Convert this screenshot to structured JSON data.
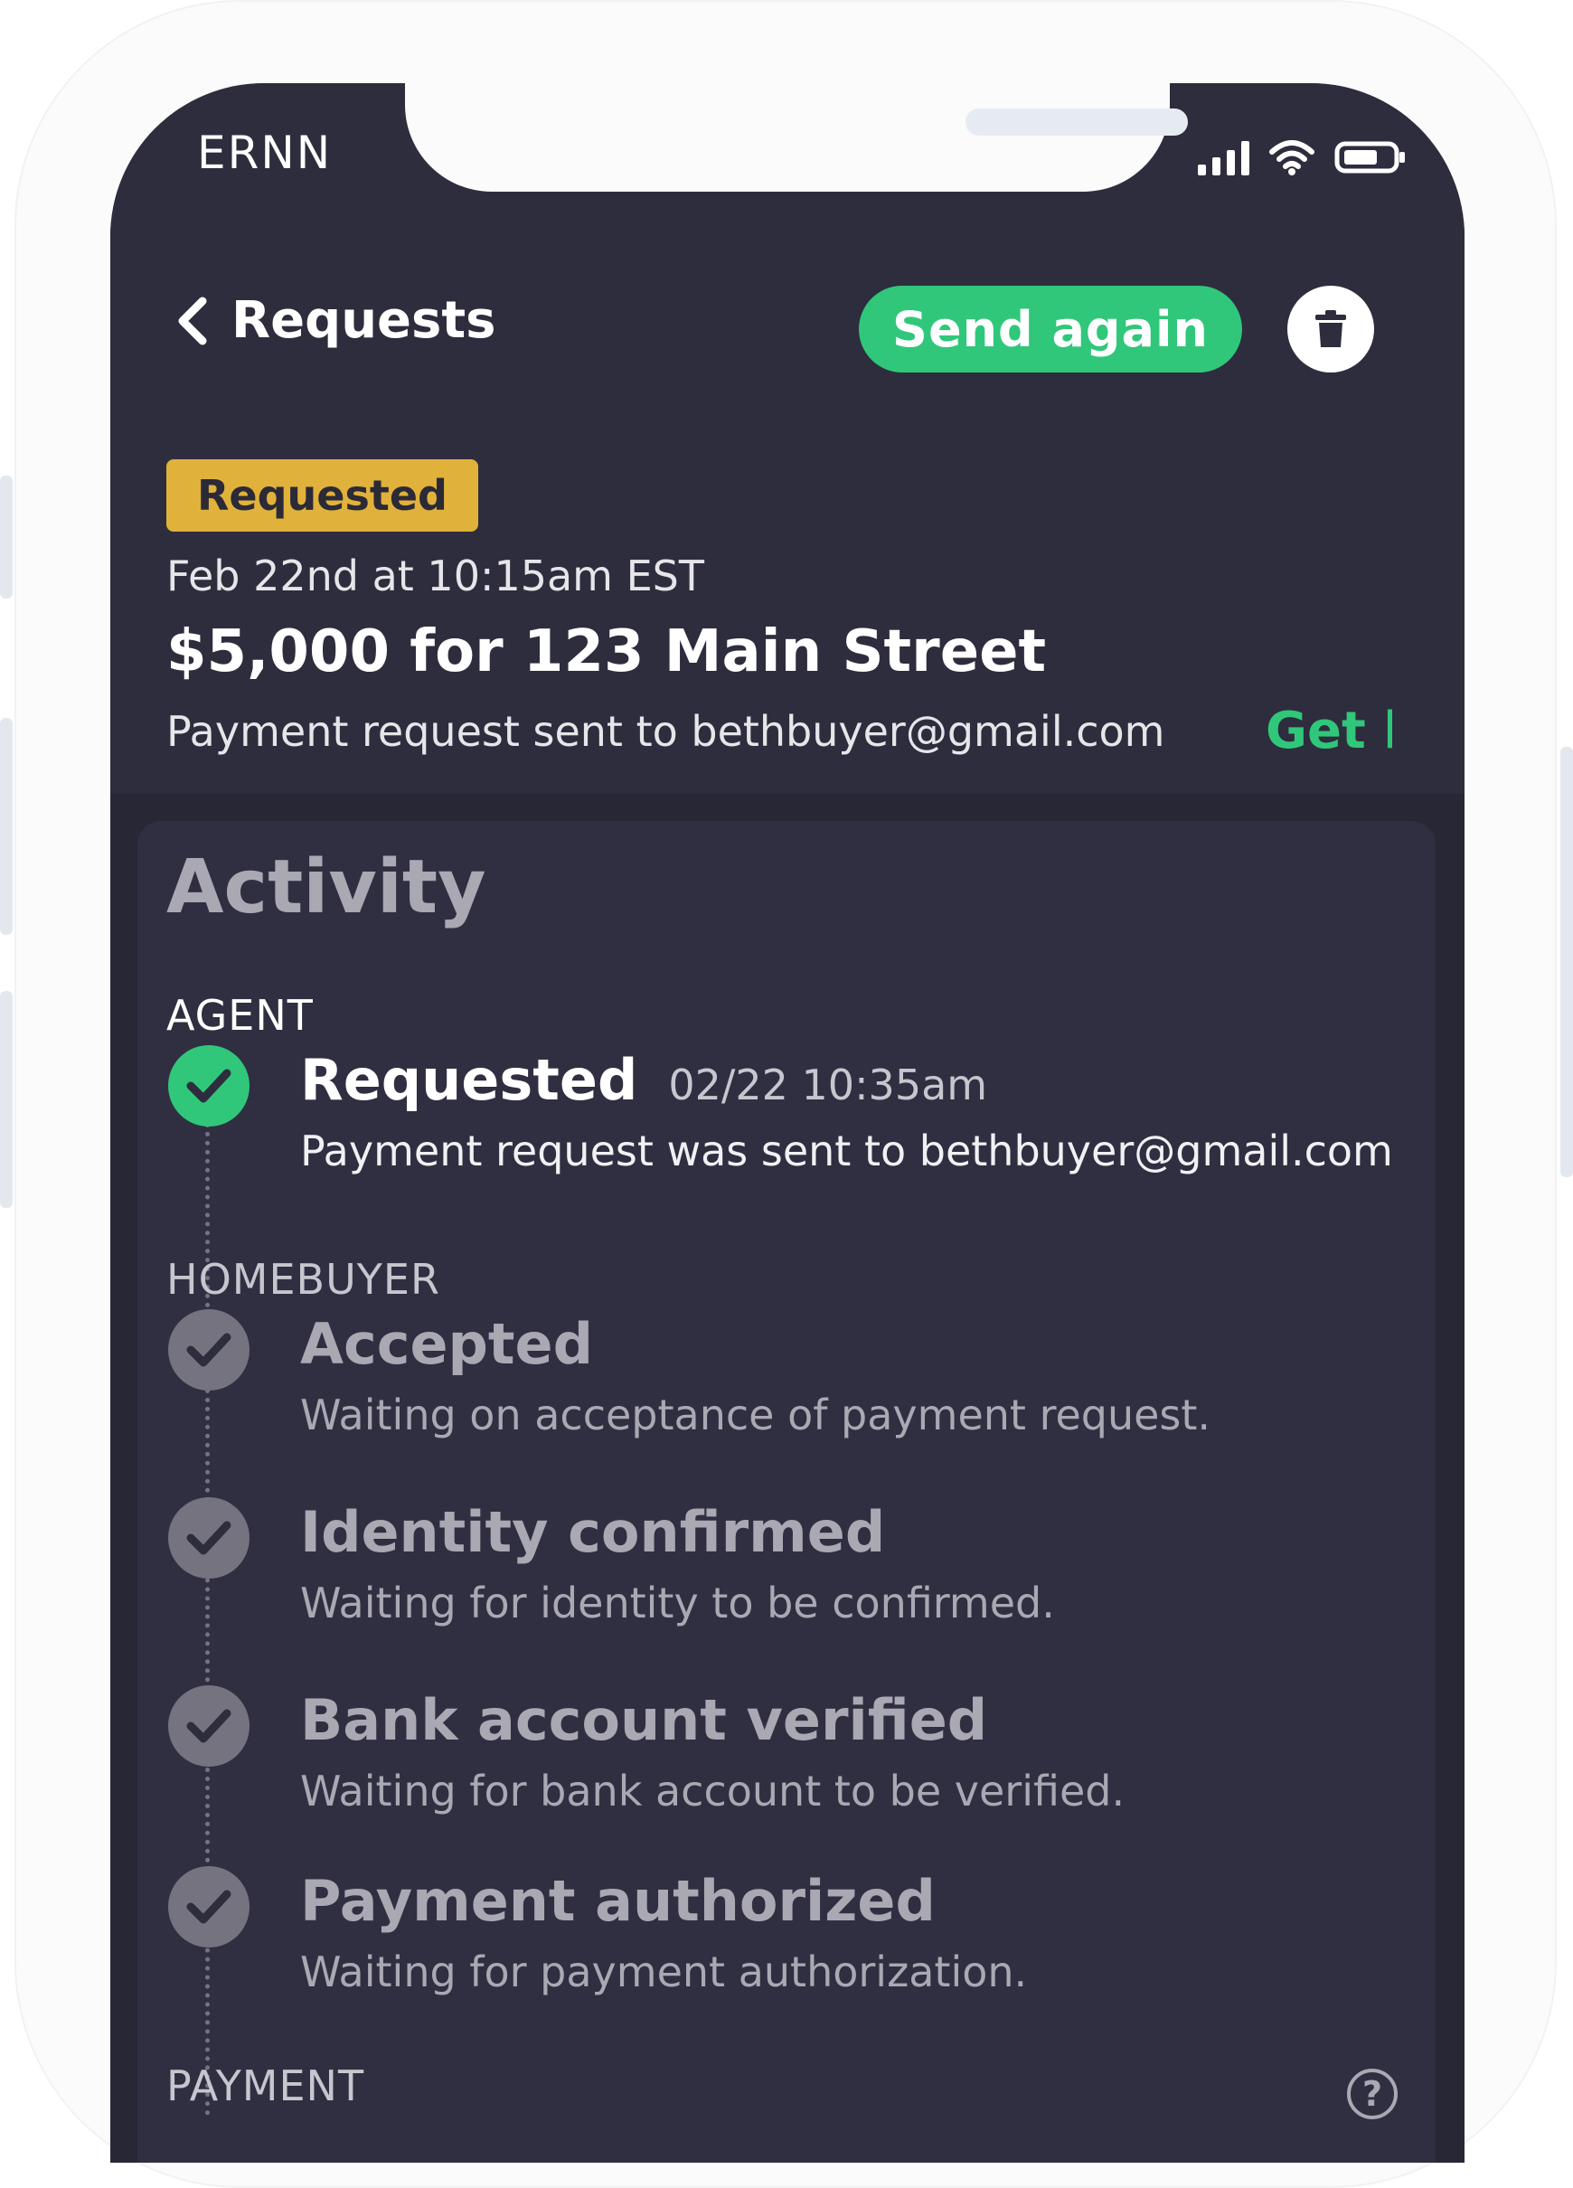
{
  "status_bar": {
    "carrier": "ERNN",
    "icons": [
      "signal-icon",
      "wifi-icon",
      "battery-icon"
    ]
  },
  "nav": {
    "back_label": "Requests",
    "send_again_label": "Send again",
    "delete_icon": "trash-icon"
  },
  "request": {
    "status_badge": "Requested",
    "date": "Feb 22nd at 10:15am EST",
    "title": "$5,000 for 123 Main Street",
    "sent_to": "Payment request sent to bethbuyer@gmail.com",
    "help_link": "Get help"
  },
  "activity": {
    "title": "Activity",
    "sections": {
      "agent": "AGENT",
      "homebuyer": "HOMEBUYER",
      "payment": "PAYMENT"
    },
    "steps": [
      {
        "title": "Requested",
        "time": "02/22 10:35am",
        "desc": "Payment request was sent to bethbuyer@gmail.com",
        "state": "done"
      },
      {
        "title": "Accepted",
        "desc": "Waiting on acceptance of payment request.",
        "state": "pending"
      },
      {
        "title": "Identity confirmed",
        "desc": "Waiting for identity to be confirmed.",
        "state": "pending"
      },
      {
        "title": "Bank account verified",
        "desc": "Waiting for bank account to be verified.",
        "state": "pending"
      },
      {
        "title": "Payment authorized",
        "desc": "Waiting for payment authorization.",
        "state": "pending"
      }
    ],
    "help_icon_label": "?"
  },
  "colors": {
    "background": "#2e2d3d",
    "accent_green": "#30c77a",
    "badge_yellow": "#e0b23c",
    "pending_gray": "#74737f"
  }
}
